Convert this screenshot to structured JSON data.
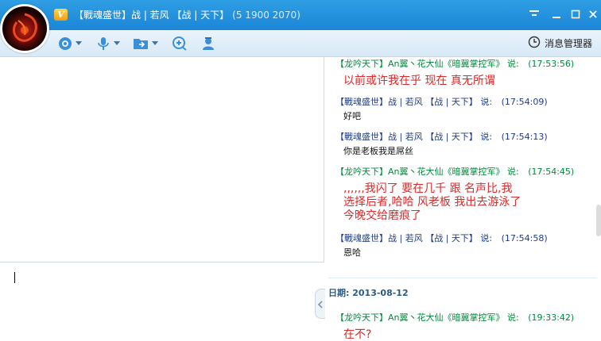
{
  "window": {
    "title": "【戰魂盛世】战 | 若风 【战 | 天下】",
    "stats": "(5   1900   2070)",
    "vip_badge": "V",
    "controls": [
      "menu-icon",
      "minimize-icon",
      "maximize-icon",
      "close-icon"
    ]
  },
  "avatar": {
    "icon": "avatar"
  },
  "toolbar": {
    "buttons": [
      "video-call-icon",
      "voice-call-icon",
      "send-file-icon",
      "remote-assist-icon",
      "contact-card-icon"
    ]
  },
  "msg_manager": {
    "label": "消息管理器",
    "icon": "clock-icon"
  },
  "input": {
    "value": ""
  },
  "chat": {
    "messages": [
      {
        "sender": "【龙吟天下】An翼丶花大仙《暗冀掌控军》",
        "said": "说:",
        "time": "(17:53:56)",
        "text": "以前或许我在乎  现在  真无所谓",
        "style": "red"
      },
      {
        "sender": "【戰魂盛世】战 | 若风  【战 | 天下】",
        "said": "说:",
        "time": "(17:54:09)",
        "text": "好吧",
        "style": "black"
      },
      {
        "sender": "【戰魂盛世】战 | 若风  【战 | 天下】",
        "said": "说:",
        "time": "(17:54:13)",
        "text": "你是老板我是屌丝",
        "style": "black"
      },
      {
        "sender": "【龙吟天下】An翼丶花大仙《暗冀掌控军》",
        "said": "说:",
        "time": "(17:54:45)",
        "lines": [
          ",,,,,,我闪了  要在几千  跟  名声比,我",
          "选择后者,哈哈  风老板  我出去游泳了",
          "今晚交给磨痕了"
        ],
        "style": "red"
      },
      {
        "sender": "【戰魂盛世】战 | 若风  【战 | 天下】",
        "said": "说:",
        "time": "(17:54:58)",
        "text": "恩哈",
        "style": "black"
      },
      {
        "sender": "【龙吟天下】An翼丶花大仙《暗冀掌控军》",
        "said": "说:",
        "time": "(19:33:42)",
        "text": "在不?",
        "style": "red"
      }
    ],
    "date_label": "日期:",
    "date_value": "2013-08-12"
  },
  "colors": {
    "titlebar": "#1b86d6",
    "toolbar": "#d8e9f7",
    "sender_green": "#008a3c",
    "sender_blue": "#1e3c8c",
    "message_red": "#d92b2b"
  }
}
